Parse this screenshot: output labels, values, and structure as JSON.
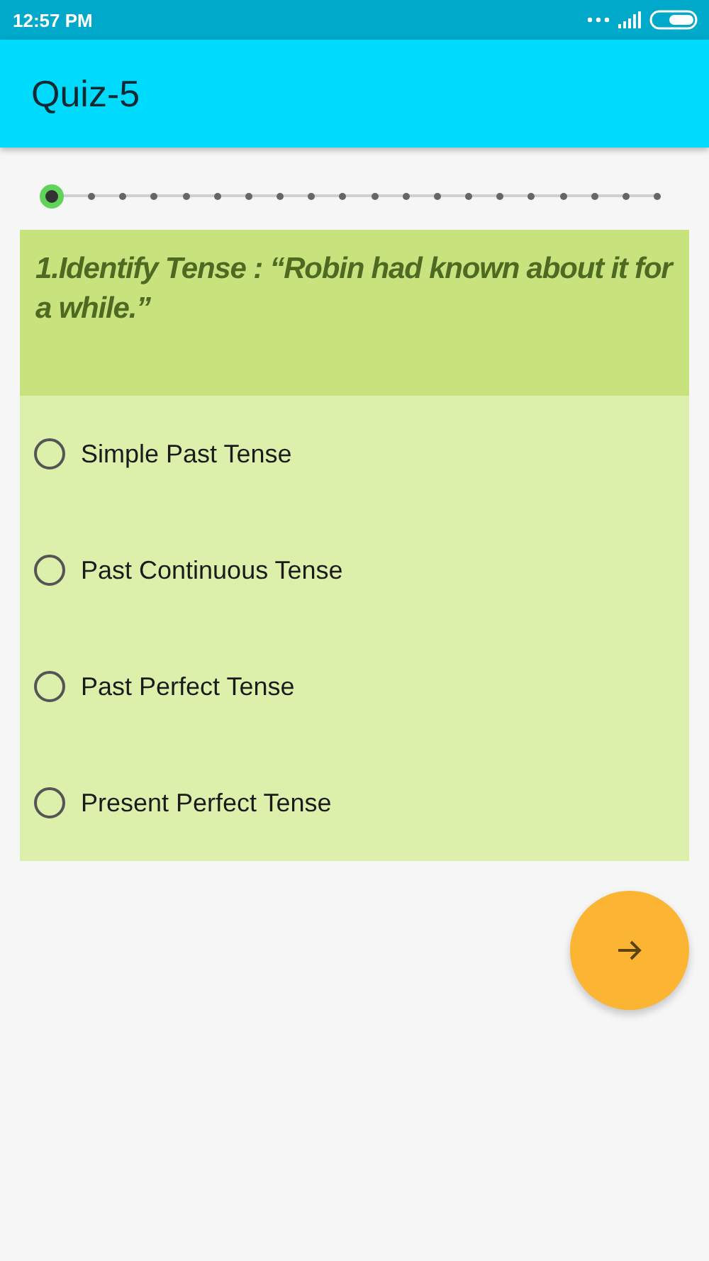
{
  "status_bar": {
    "time": "12:57 PM"
  },
  "app_bar": {
    "title": "Quiz-5"
  },
  "progress": {
    "steps": [
      {
        "selected": true
      },
      {
        "selected": false
      },
      {
        "selected": false
      },
      {
        "selected": false
      },
      {
        "selected": false
      },
      {
        "selected": false
      },
      {
        "selected": false
      },
      {
        "selected": false
      },
      {
        "selected": false
      },
      {
        "selected": false
      },
      {
        "selected": false
      },
      {
        "selected": false
      },
      {
        "selected": false
      },
      {
        "selected": false
      },
      {
        "selected": false
      },
      {
        "selected": false
      },
      {
        "selected": false
      },
      {
        "selected": false
      },
      {
        "selected": false
      },
      {
        "selected": false
      }
    ]
  },
  "question": {
    "text": "1.Identify Tense : “Robin had known about it for a while.”",
    "options": [
      {
        "label": "Simple Past Tense",
        "selected": false
      },
      {
        "label": "Past Continuous Tense",
        "selected": false
      },
      {
        "label": "Past Perfect Tense",
        "selected": false
      },
      {
        "label": "Present Perfect Tense",
        "selected": false
      }
    ]
  }
}
